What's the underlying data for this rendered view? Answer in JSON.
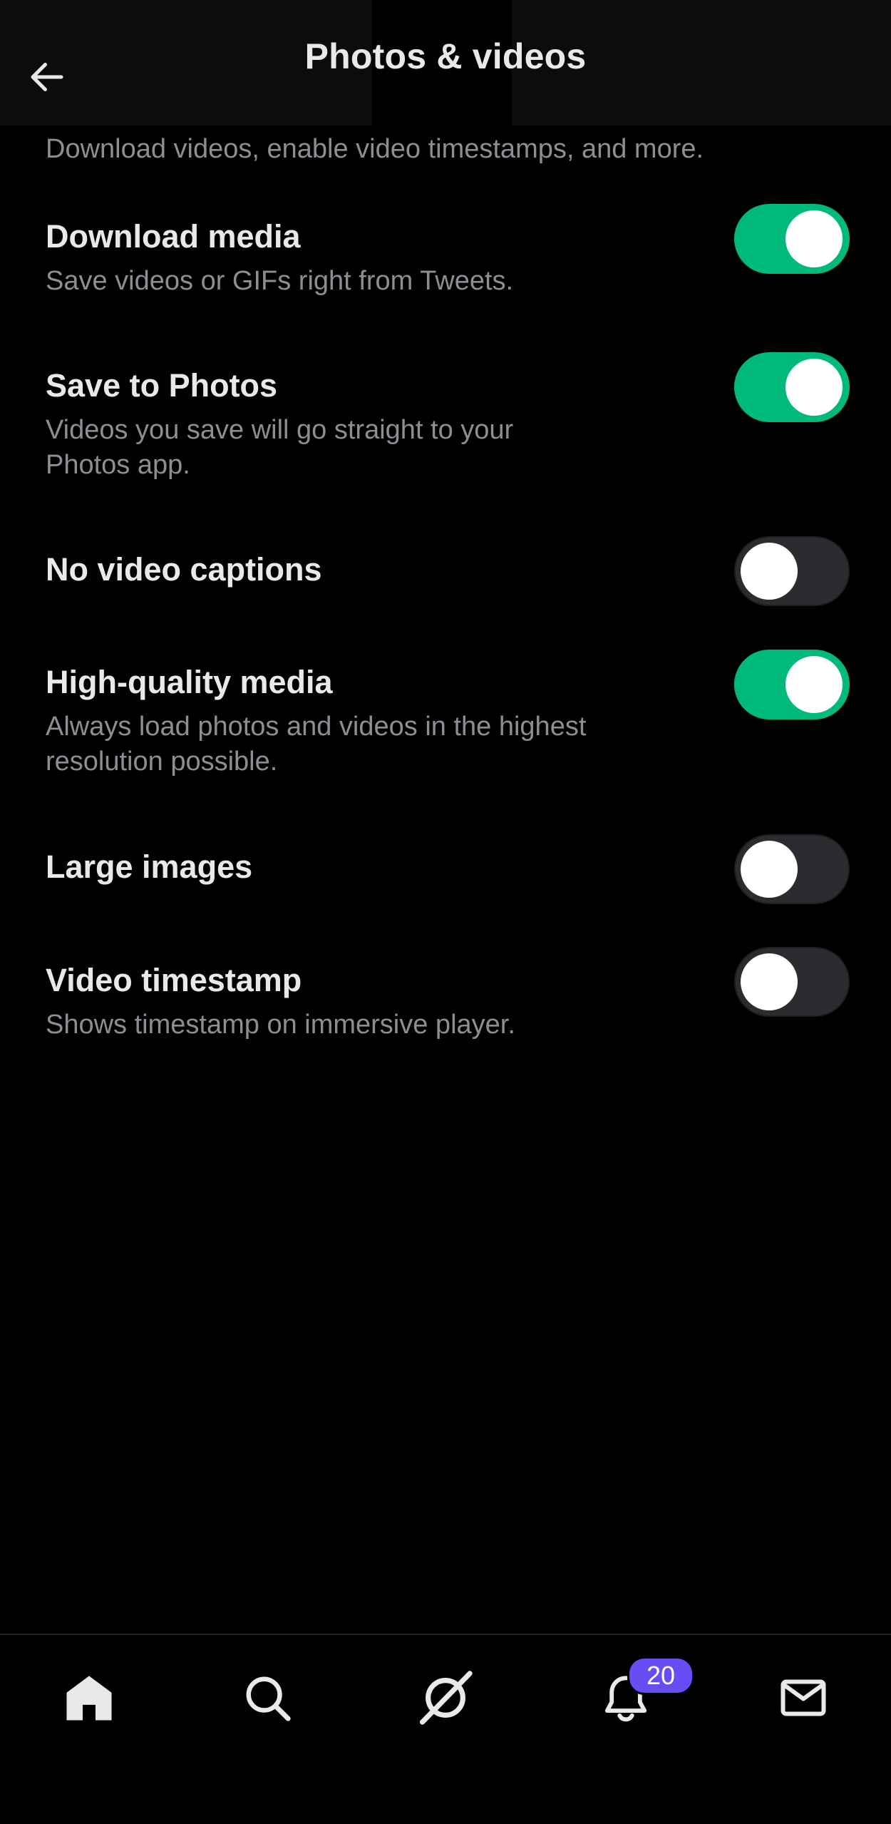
{
  "header": {
    "title": "Photos & videos",
    "back_icon": "arrow-left-icon"
  },
  "intro_text": "Download videos, enable video timestamps, and more.",
  "settings": [
    {
      "title": "Download media",
      "description": "Save videos or GIFs right from Tweets.",
      "enabled": true
    },
    {
      "title": "Save to Photos",
      "description": "Videos you save will go straight to your Photos app.",
      "enabled": true
    },
    {
      "title": "No video captions",
      "description": "",
      "enabled": false
    },
    {
      "title": "High-quality media",
      "description": "Always load photos and videos in the highest resolution possible.",
      "enabled": true
    },
    {
      "title": "Large images",
      "description": "",
      "enabled": false
    },
    {
      "title": "Video timestamp",
      "description": "Shows timestamp on immersive player.",
      "enabled": false
    }
  ],
  "bottom_nav": {
    "items": [
      {
        "name": "home",
        "icon": "home-icon"
      },
      {
        "name": "search",
        "icon": "search-icon"
      },
      {
        "name": "grok",
        "icon": "grok-icon"
      },
      {
        "name": "notifications",
        "icon": "bell-icon"
      },
      {
        "name": "messages",
        "icon": "mail-icon"
      }
    ],
    "notifications_badge": "20"
  },
  "colors": {
    "toggle_on": "#00ba7c",
    "toggle_off": "#2a2c2f",
    "badge": "#6a4cf5",
    "text_primary": "#e7e9ea",
    "text_secondary": "#8b8f94"
  }
}
